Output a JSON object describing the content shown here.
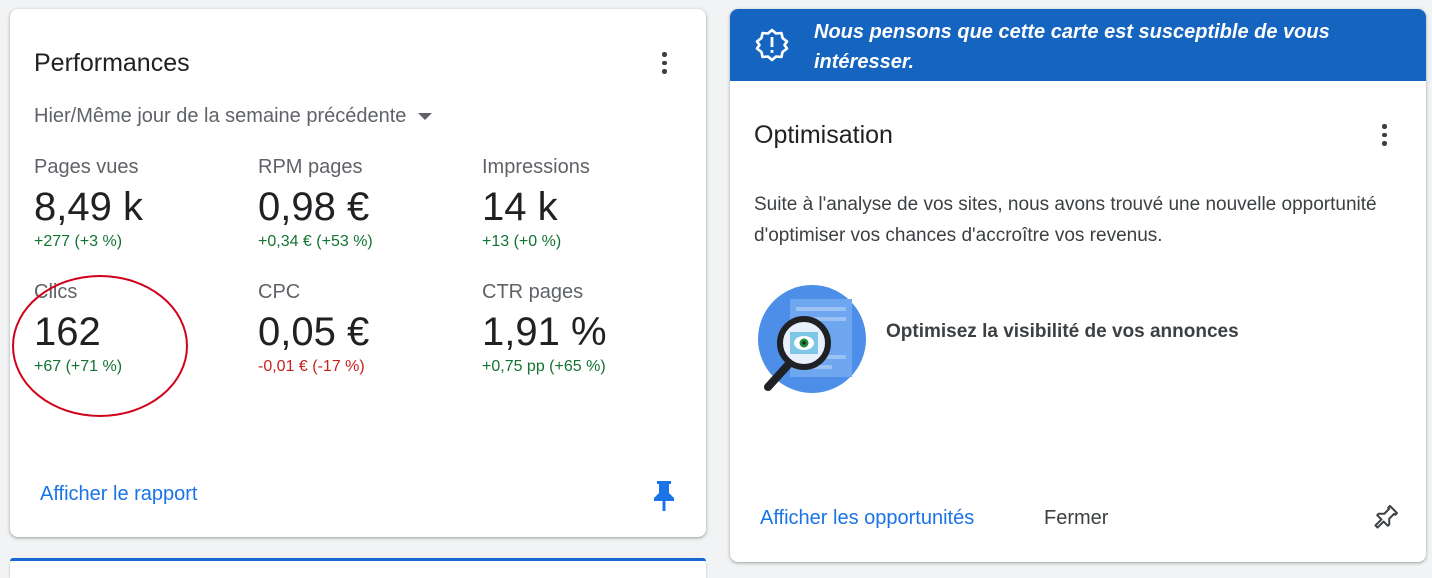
{
  "performance": {
    "title": "Performances",
    "comparison_dropdown": "Hier/Même jour de la semaine précédente",
    "metrics": [
      {
        "label": "Pages vues",
        "value": "8,49 k",
        "delta": "+277 (+3 %)",
        "trend": "positive"
      },
      {
        "label": "RPM pages",
        "value": "0,98 €",
        "delta": "+0,34 € (+53 %)",
        "trend": "positive"
      },
      {
        "label": "Impressions",
        "value": "14 k",
        "delta": "+13 (+0 %)",
        "trend": "positive"
      },
      {
        "label": "Clics",
        "value": "162",
        "delta": "+67 (+71 %)",
        "trend": "positive"
      },
      {
        "label": "CPC",
        "value": "0,05 €",
        "delta": "-0,01 € (-17 %)",
        "trend": "negative"
      },
      {
        "label": "CTR pages",
        "value": "1,91 %",
        "delta": "+0,75 pp (+65 %)",
        "trend": "positive"
      }
    ],
    "report_link": "Afficher le rapport",
    "pin_icon": "pin-filled-icon"
  },
  "optimization": {
    "banner_text": "Nous pensons que cette carte est susceptible de vous intéresser.",
    "banner_icon": "alert-badge-icon",
    "title": "Optimisation",
    "description": "Suite à l'analyse de vos sites, nous avons trouvé une nouvelle opportunité d'optimiser vos chances d'accroître vos revenus.",
    "opportunity_title": "Optimisez la visibilité de vos annonces",
    "opportunities_link": "Afficher les opportunités",
    "close_button": "Fermer",
    "pin_icon": "pin-outline-icon"
  },
  "colors": {
    "accent": "#1a73e8",
    "banner": "#1565c0",
    "positive": "#137333",
    "negative": "#c5221f",
    "annotation": "#d0021b"
  }
}
